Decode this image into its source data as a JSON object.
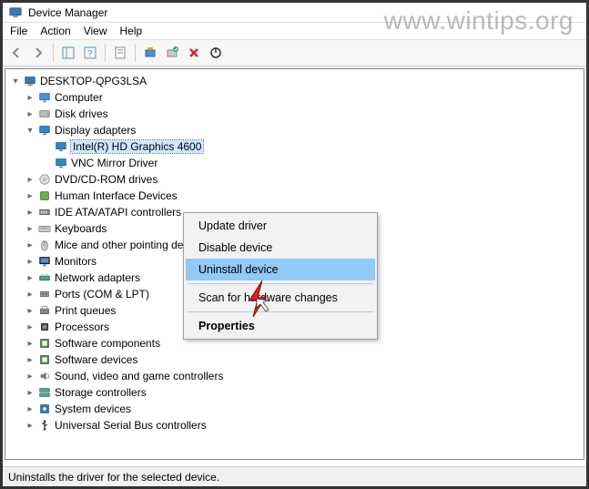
{
  "watermark": "www.wintips.org",
  "window": {
    "title": "Device Manager"
  },
  "menubar": [
    "File",
    "Action",
    "View",
    "Help"
  ],
  "tree": {
    "root": "DESKTOP-QPG3LSA",
    "categories": [
      {
        "label": "Computer",
        "icon": "computer-icon"
      },
      {
        "label": "Disk drives",
        "icon": "disk-icon"
      },
      {
        "label": "Display adapters",
        "icon": "display-icon",
        "expanded": true,
        "children": [
          {
            "label": "Intel(R) HD Graphics 4600",
            "icon": "display-icon",
            "selected": true
          },
          {
            "label": "VNC Mirror Driver",
            "icon": "display-icon"
          }
        ]
      },
      {
        "label": "DVD/CD-ROM drives",
        "icon": "cdrom-icon"
      },
      {
        "label": "Human Interface Devices",
        "icon": "hid-icon"
      },
      {
        "label": "IDE ATA/ATAPI controllers",
        "icon": "ide-icon"
      },
      {
        "label": "Keyboards",
        "icon": "keyboard-icon"
      },
      {
        "label": "Mice and other pointing devices",
        "icon": "mouse-icon"
      },
      {
        "label": "Monitors",
        "icon": "monitor-icon"
      },
      {
        "label": "Network adapters",
        "icon": "network-icon"
      },
      {
        "label": "Ports (COM & LPT)",
        "icon": "port-icon"
      },
      {
        "label": "Print queues",
        "icon": "printer-icon"
      },
      {
        "label": "Processors",
        "icon": "cpu-icon"
      },
      {
        "label": "Software components",
        "icon": "software-icon"
      },
      {
        "label": "Software devices",
        "icon": "software-icon"
      },
      {
        "label": "Sound, video and game controllers",
        "icon": "sound-icon"
      },
      {
        "label": "Storage controllers",
        "icon": "storage-icon"
      },
      {
        "label": "System devices",
        "icon": "system-icon"
      },
      {
        "label": "Universal Serial Bus controllers",
        "icon": "usb-icon"
      }
    ]
  },
  "context_menu": {
    "items": [
      {
        "label": "Update driver"
      },
      {
        "label": "Disable device"
      },
      {
        "label": "Uninstall device",
        "highlight": true
      },
      {
        "sep": true
      },
      {
        "label": "Scan for hardware changes"
      },
      {
        "sep": true
      },
      {
        "label": "Properties",
        "bold": true
      }
    ]
  },
  "statusbar": "Uninstalls the driver for the selected device."
}
